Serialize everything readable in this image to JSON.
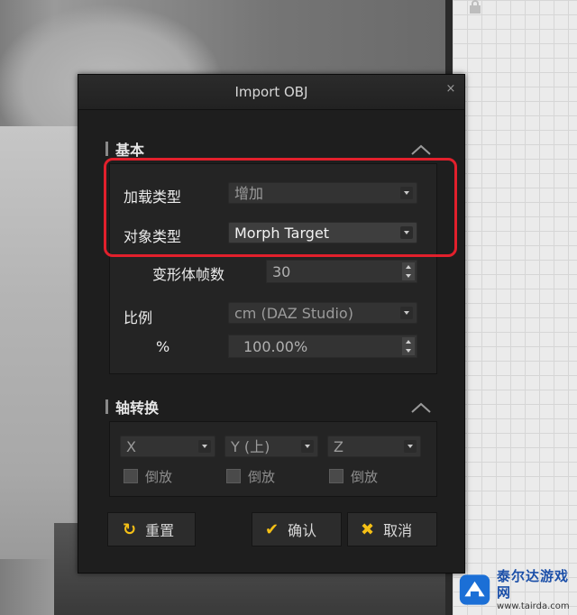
{
  "dialog": {
    "title": "Import OBJ",
    "close_glyph": "×"
  },
  "basic": {
    "heading": "基本",
    "load_type_label": "加载类型",
    "load_type_value": "增加",
    "object_type_label": "对象类型",
    "object_type_value": "Morph Target",
    "morph_frames_label": "变形体帧数",
    "morph_frames_value": "30",
    "scale_label": "比例",
    "scale_value": "cm (DAZ Studio)",
    "percent_label": "%",
    "percent_value": "100.00%"
  },
  "axis": {
    "heading": "轴转换",
    "x_value": "X",
    "y_value": "Y (上)",
    "z_value": "Z",
    "invert_label": "倒放"
  },
  "buttons": {
    "reset": "重置",
    "reset_icon": "↻",
    "confirm": "确认",
    "confirm_icon": "✔",
    "cancel": "取消",
    "cancel_icon": "✖"
  },
  "watermark": {
    "title": "泰尔达游戏网",
    "url": "www.tairda.com"
  },
  "colors": {
    "accent": "#f5c016",
    "highlight": "#e2202c"
  }
}
